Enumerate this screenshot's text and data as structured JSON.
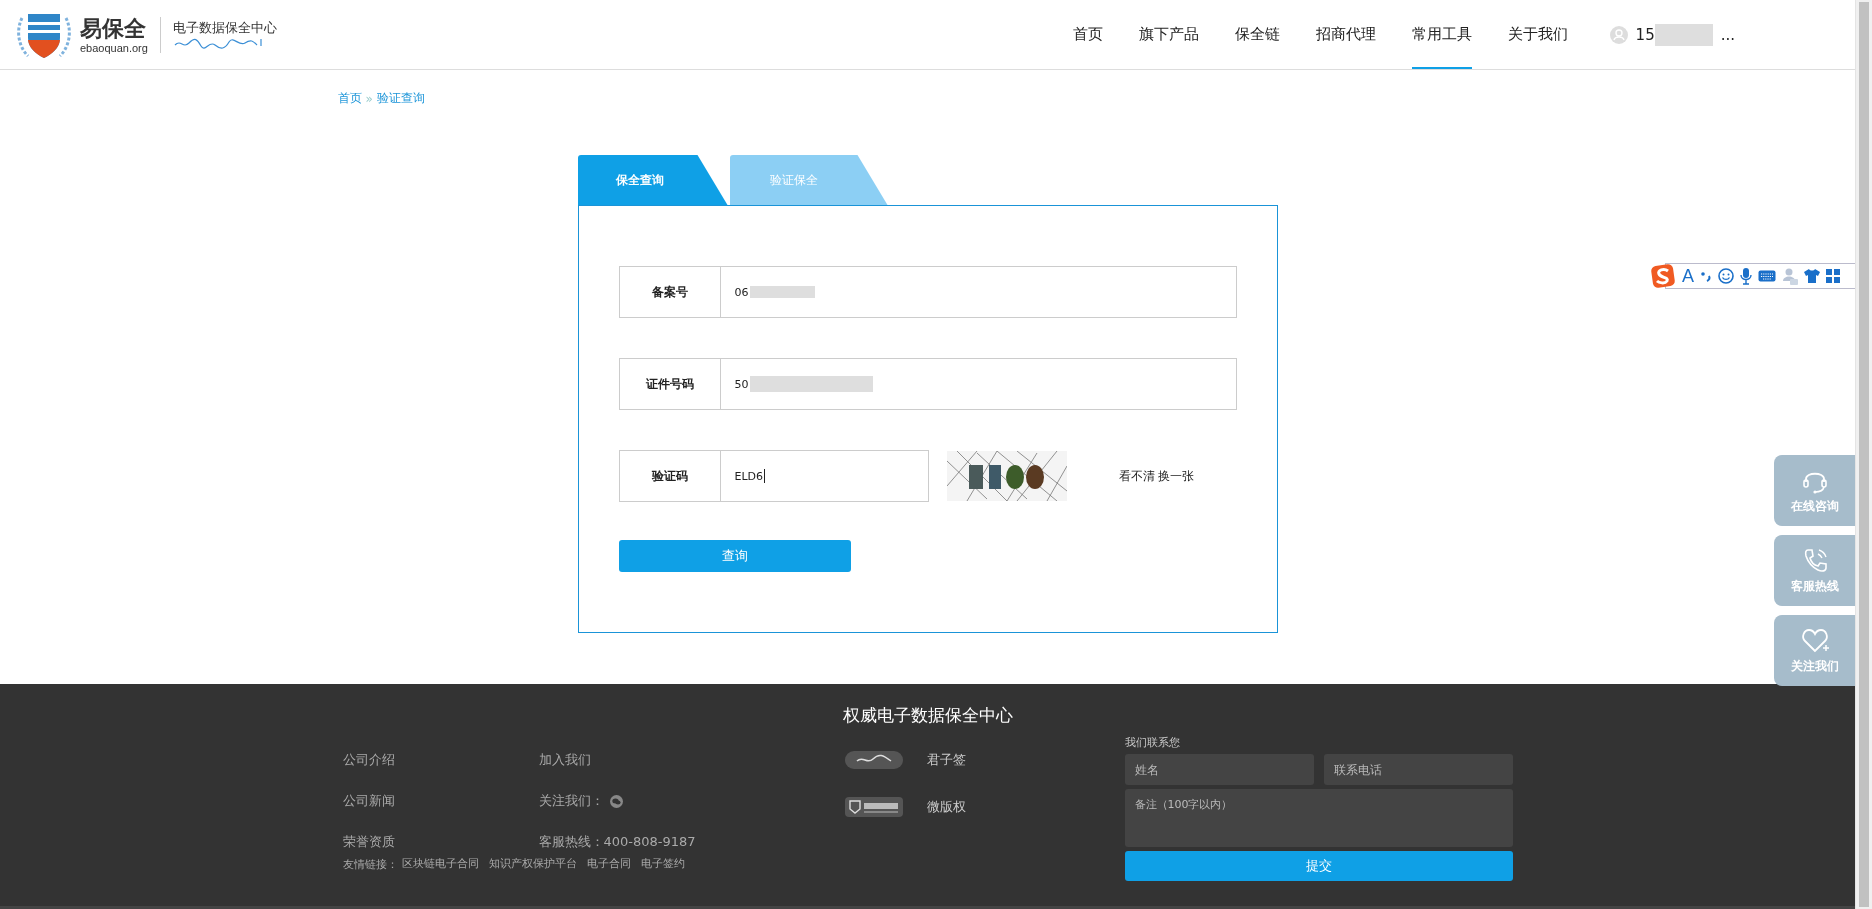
{
  "site_header": {
    "brand": "易保全",
    "domain": "ebaoquan.org",
    "tagline": "电子数据保全中心"
  },
  "nav": [
    {
      "label": "首页",
      "selected": false
    },
    {
      "label": "旗下产品",
      "selected": false
    },
    {
      "label": "保全链",
      "selected": false
    },
    {
      "label": "招商代理",
      "selected": false
    },
    {
      "label": "常用工具",
      "selected": true
    },
    {
      "label": "关于我们",
      "selected": false
    }
  ],
  "user": {
    "name": "15",
    "redacted": true,
    "ellipsis": "..."
  },
  "breadcrumb": {
    "separator": "»",
    "items": [
      "首页",
      "验证查询"
    ]
  },
  "tabs": [
    {
      "label": "保全查询",
      "selected": true
    },
    {
      "label": "验证保全",
      "selected": false
    }
  ],
  "form": {
    "fields": [
      {
        "kind": "text",
        "label": "备案号",
        "value": "06",
        "redacted": true
      },
      {
        "kind": "text",
        "label": "证件号码",
        "value": "50",
        "redacted": true
      },
      {
        "kind": "captcha",
        "label": "验证码",
        "value": "ELD6",
        "refresh_link": "看不清 换一张"
      }
    ],
    "submit": "查询"
  },
  "ime_toolbar": [
    {
      "kind": "logo"
    },
    {
      "kind": "letter",
      "text": "A"
    },
    {
      "kind": "punct"
    },
    {
      "kind": "emoji"
    },
    {
      "kind": "mic"
    },
    {
      "kind": "keyboard"
    },
    {
      "kind": "user"
    },
    {
      "kind": "shirt"
    },
    {
      "kind": "grid"
    }
  ],
  "float_buttons": [
    {
      "kind": "headset",
      "label": "在线咨询"
    },
    {
      "kind": "phone",
      "label": "客服热线"
    },
    {
      "kind": "heart",
      "label": "关注我们"
    }
  ],
  "footer": {
    "title": "权威电子数据保全中心",
    "column_1": [
      "公司介绍",
      "公司新闻",
      "荣誉资质"
    ],
    "column_2": [
      {
        "kind": "text",
        "label": "加入我们"
      },
      {
        "kind": "wechat",
        "label": "关注我们："
      },
      {
        "kind": "text",
        "label": "客服热线：400-808-9187"
      }
    ],
    "partners": [
      {
        "kind": "junzi",
        "name": "君子签"
      },
      {
        "kind": "weibanquan",
        "name": "微版权"
      }
    ],
    "friend_links": {
      "label": "友情链接：",
      "items": [
        "区块链电子合同",
        "知识产权保护平台",
        "电子合同",
        "电子签约"
      ]
    },
    "contact": {
      "title": "我们联系您",
      "name_placeholder": "姓名",
      "phone_placeholder": "联系电话",
      "note_placeholder": "备注（100字以内）",
      "submit": "提交"
    }
  }
}
